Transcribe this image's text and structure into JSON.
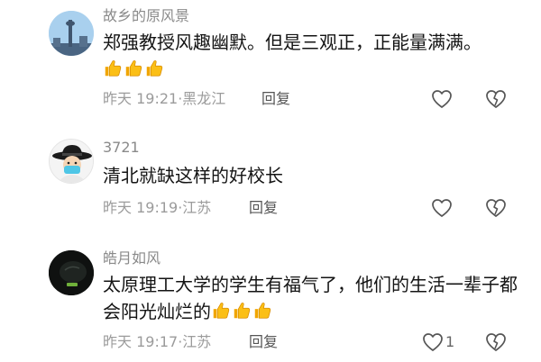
{
  "comments": [
    {
      "username": "故乡的原风景",
      "text": "郑强教授风趣幽默。但是三观正，正能量满满。",
      "emoji_count": 3,
      "time": "昨天 19:21",
      "location": "黑龙江",
      "reply_label": "回复",
      "likes": ""
    },
    {
      "username": "3721",
      "text": "清北就缺这样的好校长",
      "emoji_count": 0,
      "time": "昨天 19:19",
      "location": "江苏",
      "reply_label": "回复",
      "likes": ""
    },
    {
      "username": "皓月如风",
      "text": "太原理工大学的学生有福气了，他们的生活一辈子都会阳光灿烂的",
      "emoji_count": 3,
      "time": "昨天 19:17",
      "location": "江苏",
      "reply_label": "回复",
      "likes": "1"
    }
  ],
  "icons": {
    "like": "heart-outline-icon",
    "dislike": "broken-heart-icon",
    "emoji": "thumbs-up-emoji"
  },
  "colors": {
    "username": "#8a8a8a",
    "text": "#141414",
    "meta": "#9b9b9b",
    "emoji": "#f6b400"
  }
}
